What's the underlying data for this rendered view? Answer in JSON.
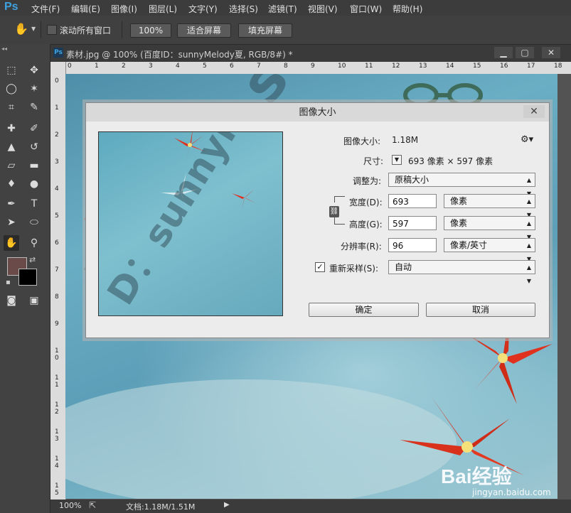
{
  "app": {
    "logo": "Ps"
  },
  "menu": [
    "文件(F)",
    "编辑(E)",
    "图像(I)",
    "图层(L)",
    "文字(Y)",
    "选择(S)",
    "滤镜(T)",
    "视图(V)",
    "窗口(W)",
    "帮助(H)"
  ],
  "options": {
    "scroll_all_label": "滚动所有窗口",
    "zoom_100_label": "100%",
    "fit_screen_label": "适合屏幕",
    "fill_screen_label": "填充屏幕"
  },
  "document": {
    "tab_title": "素材.jpg @ 100% (百度ID：sunnyMelody夏, RGB/8#) *",
    "hruler_ticks": [
      "0",
      "1",
      "2",
      "3",
      "4",
      "5",
      "6",
      "7",
      "8",
      "9",
      "10",
      "11",
      "12",
      "13",
      "14",
      "15",
      "16",
      "17",
      "18"
    ],
    "vruler_ticks": [
      "0",
      "1",
      "2",
      "3",
      "4",
      "5",
      "6",
      "7",
      "8",
      "9",
      "1\n0",
      "1\n1",
      "1\n2",
      "1\n3",
      "1\n4",
      "1\n5"
    ],
    "watermark_text": "百度ID：sunnyMe",
    "overlay_logo": "Bai经验",
    "overlay_url": "jingyan.baidu.com"
  },
  "status": {
    "zoom": "100%",
    "doc_info": "文档:1.18M/1.51M"
  },
  "dialog": {
    "title": "图像大小",
    "image_size_label": "图像大小:",
    "image_size_value": "1.18M",
    "dimensions_label": "尺寸:",
    "dimensions_value": "693 像素 × 597 像素",
    "fit_to_label": "调整为:",
    "fit_to_value": "原稿大小",
    "width_label": "宽度(D):",
    "width_value": "693",
    "width_unit": "像素",
    "height_label": "高度(G):",
    "height_value": "597",
    "height_unit": "像素",
    "resolution_label": "分辨率(R):",
    "resolution_value": "96",
    "resolution_unit": "像素/英寸",
    "resample_label": "重新采样(S):",
    "resample_checked": true,
    "resample_value": "自动",
    "ok_label": "确定",
    "cancel_label": "取消",
    "preview_watermark": "D：sunnyMe"
  },
  "colors": {
    "accent": "#3fa2e0",
    "foreground_swatch": "#6b4a4a",
    "background_swatch": "#000000",
    "flower_red": "#e0301e"
  }
}
